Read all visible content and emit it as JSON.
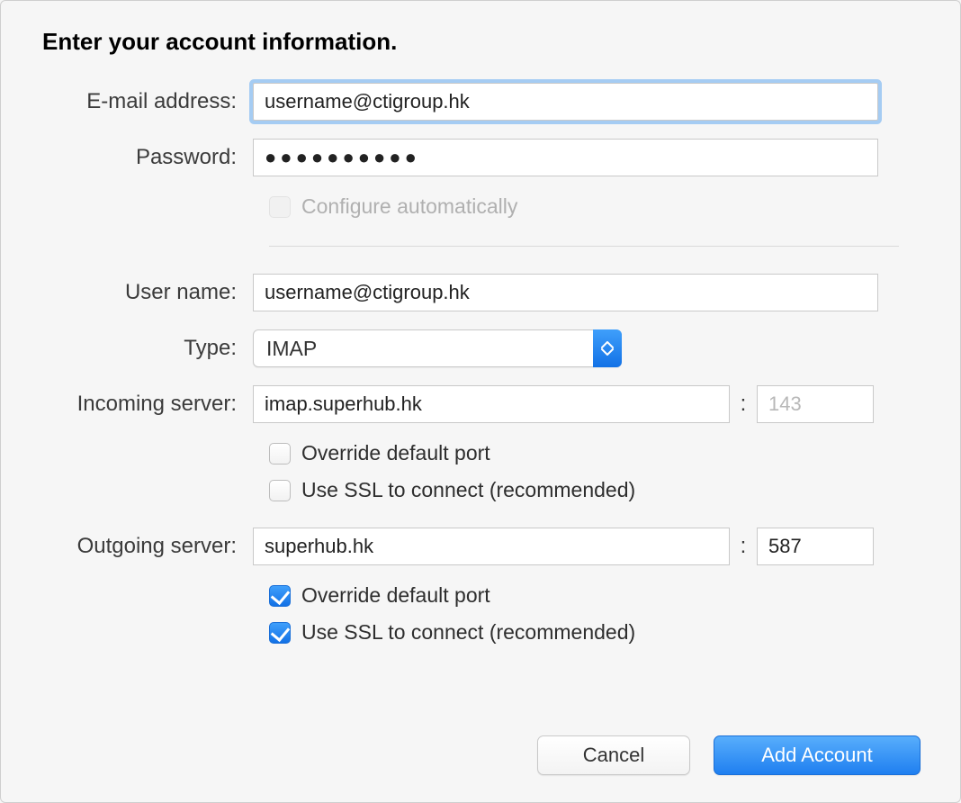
{
  "title": "Enter your account information.",
  "labels": {
    "email": "E-mail address:",
    "password": "Password:",
    "configure_auto": "Configure automatically",
    "username": "User name:",
    "type": "Type:",
    "incoming": "Incoming server:",
    "outgoing": "Outgoing server:",
    "override_port": "Override default port",
    "use_ssl": "Use SSL to connect (recommended)"
  },
  "values": {
    "email": "username@ctigroup.hk",
    "password_mask": "●●●●●●●●●●",
    "username": "username@ctigroup.hk",
    "type": "IMAP",
    "incoming_server": "imap.superhub.hk",
    "incoming_port": "143",
    "outgoing_server": "superhub.hk",
    "outgoing_port": "587"
  },
  "checks": {
    "configure_auto": false,
    "incoming_override": false,
    "incoming_ssl": false,
    "outgoing_override": true,
    "outgoing_ssl": true
  },
  "buttons": {
    "cancel": "Cancel",
    "add": "Add Account"
  },
  "colon": ":"
}
